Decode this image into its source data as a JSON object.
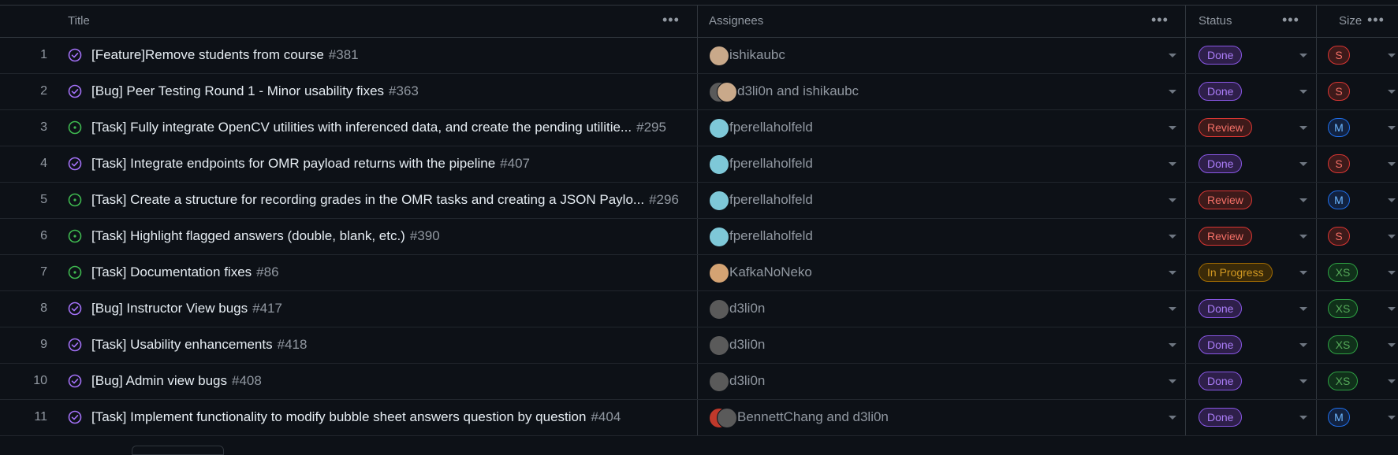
{
  "columns": {
    "title": "Title",
    "assignees": "Assignees",
    "status": "Status",
    "size": "Size",
    "menu_glyph": "•••"
  },
  "colors": {
    "done": "#8957e5",
    "review": "#da3633",
    "in_progress": "#9e6a03",
    "closed_issue_icon": "#a371f7",
    "open_issue_icon": "#3fb950"
  },
  "rows": [
    {
      "n": "1",
      "state": "closed",
      "title": "[Feature]Remove students from course",
      "issue": "#381",
      "assignees": "ishikaubc",
      "avatars": [
        "#c9a98a"
      ],
      "status": "Done",
      "size": "S"
    },
    {
      "n": "2",
      "state": "closed",
      "title": "[Bug] Peer Testing Round 1 - Minor usability fixes",
      "issue": "#363",
      "assignees": "d3li0n and ishikaubc",
      "avatars": [
        "#5a5a5a",
        "#c9a98a"
      ],
      "status": "Done",
      "size": "S"
    },
    {
      "n": "3",
      "state": "open",
      "title": "[Task] Fully integrate OpenCV utilities with inferenced data, and create the pending utilitie...",
      "issue": "#295",
      "assignees": "fperellaholfeld",
      "avatars": [
        "#7ec8d8"
      ],
      "status": "Review",
      "size": "M"
    },
    {
      "n": "4",
      "state": "closed",
      "title": "[Task] Integrate endpoints for OMR payload returns with the pipeline",
      "issue": "#407",
      "assignees": "fperellaholfeld",
      "avatars": [
        "#7ec8d8"
      ],
      "status": "Done",
      "size": "S"
    },
    {
      "n": "5",
      "state": "open",
      "title": "[Task] Create a structure for recording grades in the OMR tasks and creating a JSON Paylo...",
      "issue": "#296",
      "assignees": "fperellaholfeld",
      "avatars": [
        "#7ec8d8"
      ],
      "status": "Review",
      "size": "M"
    },
    {
      "n": "6",
      "state": "open",
      "title": "[Task] Highlight flagged answers (double, blank, etc.)",
      "issue": "#390",
      "assignees": "fperellaholfeld",
      "avatars": [
        "#7ec8d8"
      ],
      "status": "Review",
      "size": "S"
    },
    {
      "n": "7",
      "state": "open",
      "title": "[Task] Documentation fixes",
      "issue": "#86",
      "assignees": "KafkaNoNeko",
      "avatars": [
        "#d4a373"
      ],
      "status": "In Progress",
      "size": "XS"
    },
    {
      "n": "8",
      "state": "closed",
      "title": "[Bug] Instructor View bugs",
      "issue": "#417",
      "assignees": "d3li0n",
      "avatars": [
        "#5a5a5a"
      ],
      "status": "Done",
      "size": "XS"
    },
    {
      "n": "9",
      "state": "closed",
      "title": "[Task] Usability enhancements",
      "issue": "#418",
      "assignees": "d3li0n",
      "avatars": [
        "#5a5a5a"
      ],
      "status": "Done",
      "size": "XS"
    },
    {
      "n": "10",
      "state": "closed",
      "title": "[Bug] Admin view bugs",
      "issue": "#408",
      "assignees": "d3li0n",
      "avatars": [
        "#5a5a5a"
      ],
      "status": "Done",
      "size": "XS"
    },
    {
      "n": "11",
      "state": "closed",
      "title": "[Task] Implement functionality to modify bubble sheet answers question by question",
      "issue": "#404",
      "assignees": "BennettChang and d3li0n",
      "avatars": [
        "#c0392b",
        "#5a5a5a"
      ],
      "status": "Done",
      "size": "M"
    }
  ]
}
